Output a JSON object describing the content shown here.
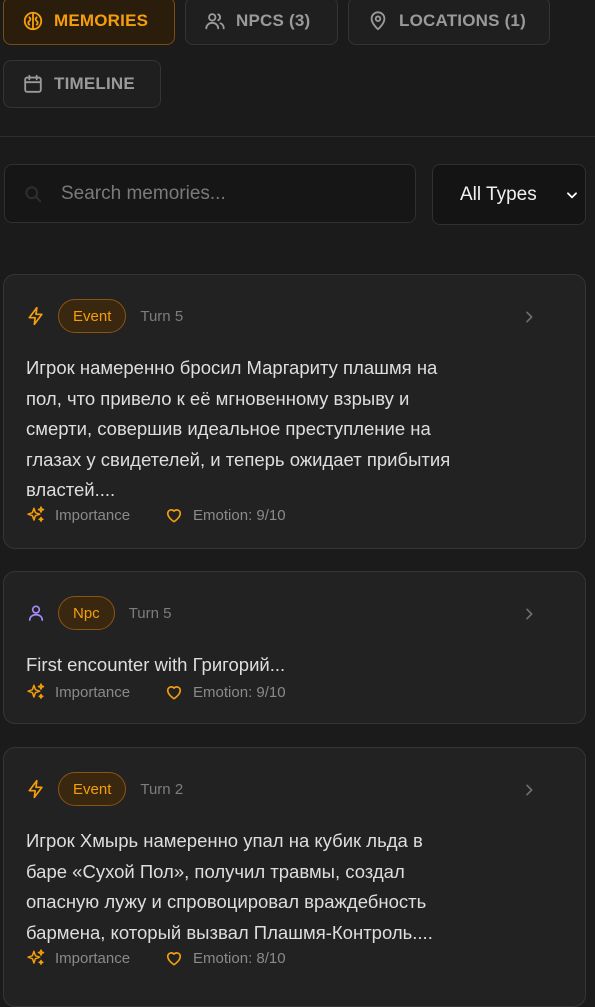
{
  "tabs": [
    {
      "label": "MEMORIES",
      "icon": "brain-icon",
      "active": true
    },
    {
      "label": "NPCS (3)",
      "icon": "users-icon",
      "active": false
    },
    {
      "label": "LOCATIONS (1)",
      "icon": "map-pin-icon",
      "active": false
    },
    {
      "label": "TIMELINE",
      "icon": "calendar-icon",
      "active": false
    }
  ],
  "search": {
    "placeholder": "Search memories...",
    "value": ""
  },
  "filter": {
    "selected": "All Types"
  },
  "colors": {
    "accent": "#f59e0b",
    "npc": "#a78bfa",
    "background": "#1b1b1b",
    "card": "#222222"
  },
  "memories": [
    {
      "type_icon": "lightning-icon",
      "type": "Event",
      "turn": "Turn 5",
      "text": "Игрок намеренно бросил Маргариту плашмя на пол, что привело к её мгновенному взрыву и смерти, совершив идеальное преступление на глазах у свидетелей, и теперь ожидает прибытия властей....",
      "importance_label": "Importance",
      "emotion_label": "Emotion: 9/10"
    },
    {
      "type_icon": "user-icon",
      "type": "Npc",
      "turn": "Turn 5",
      "text": "First encounter with Григорий...",
      "importance_label": "Importance",
      "emotion_label": "Emotion: 9/10"
    },
    {
      "type_icon": "lightning-icon",
      "type": "Event",
      "turn": "Turn 2",
      "text": "Игрок Хмырь намеренно упал на кубик льда в баре «Сухой Пол», получил травмы, создал опасную лужу и спровоцировал враждебность бармена, который вызвал Плашмя-Контроль....",
      "importance_label": "Importance",
      "emotion_label": "Emotion: 8/10"
    }
  ]
}
